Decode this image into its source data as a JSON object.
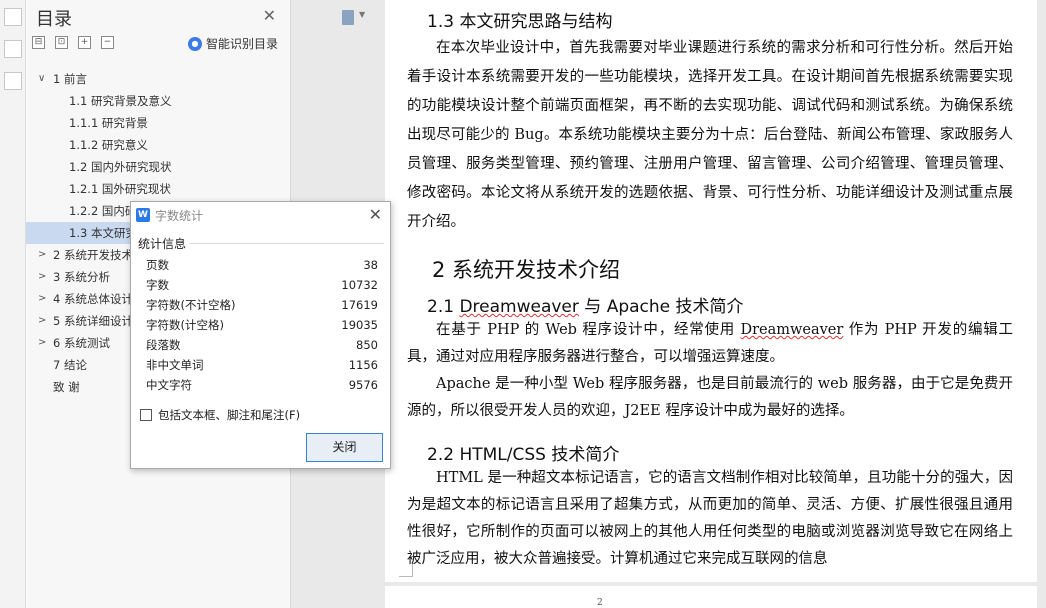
{
  "outline": {
    "title": "目录",
    "smart_label": "智能识别目录",
    "tools": [
      "⊟",
      "⊡",
      "+",
      "−"
    ],
    "items": [
      {
        "label": "1  前言",
        "level": 1,
        "expandable": true,
        "expanded": true
      },
      {
        "label": "1.1 研究背景及意义",
        "level": 2
      },
      {
        "label": "1.1.1  研究背景",
        "level": 2
      },
      {
        "label": "1.1.2  研究意义",
        "level": 2
      },
      {
        "label": "1.2 国内外研究现状",
        "level": 2
      },
      {
        "label": "1.2.1 国外研究现状",
        "level": 2
      },
      {
        "label": "1.2.2 国内研究现状",
        "level": 2
      },
      {
        "label": "1.3 本文研究思路与结构",
        "level": 2,
        "selected": true
      },
      {
        "label": "2 系统开发技术介绍",
        "level": 1,
        "expandable": true
      },
      {
        "label": "3  系统分析",
        "level": 1,
        "expandable": true
      },
      {
        "label": "4  系统总体设计",
        "level": 1,
        "expandable": true
      },
      {
        "label": "5  系统详细设计",
        "level": 1,
        "expandable": true
      },
      {
        "label": "6  系统测试",
        "level": 1,
        "expandable": true
      },
      {
        "label": "7 结论",
        "level": 1
      },
      {
        "label": "致  谢",
        "level": 1
      }
    ]
  },
  "document": {
    "heading_1_3": "1.3 本文研究思路与结构",
    "para_1_3": "在本次毕业设计中，首先我需要对毕业课题进行系统的需求分析和可行性分析。然后开始着手设计本系统需要开发的一些功能模块，选择开发工具。在设计期间首先根据系统需要实现的功能模块设计整个前端页面框架，再不断的去实现功能、调试代码和测试系统。为确保系统出现尽可能少的 Bug。本系统功能模块主要分为十点：后台登陆、新闻公布管理、家政服务人员管理、服务类型管理、预约管理、注册用户管理、留言管理、公司介绍管理、管理员管理、修改密码。本论文将从系统开发的选题依据、背景、可行性分析、功能详细设计及测试重点展开介绍。",
    "heading_2": "2 系统开发技术介绍",
    "heading_2_1_prefix": "2.1 ",
    "heading_2_1_word": "Dreamweaver",
    "heading_2_1_suffix": " 与 Apache 技术简介",
    "para_2_1a_prefix": "在基于 PHP 的 Web 程序设计中，经常使用 ",
    "para_2_1a_word": "Dreamweaver",
    "para_2_1a_suffix": " 作为 PHP 开发的编辑工具，通过对应用程序服务器进行整合，可以增强运算速度。",
    "para_2_1b": "Apache 是一种小型 Web 程序服务器，也是目前最流行的 web 服务器，由于它是免费开源的，所以很受开发人员的欢迎，J2EE 程序设计中成为最好的选择。",
    "heading_2_2": "2.2 HTML/CSS 技术简介",
    "para_2_2": "HTML 是一种超文本标记语言，它的语言文档制作相对比较简单，且功能十分的强大，因为是超文本的标记语言且采用了超集方式，从而更加的简单、灵活、方便、扩展性很强且通用性很好，它所制作的页面可以被网上的其他人用任何类型的电脑或浏览器浏览导致它在网络上被广泛应用，被大众普遍接受。计算机通过它来完成互联网的信息",
    "page_number": "2"
  },
  "dialog": {
    "title": "字数统计",
    "group_label": "统计信息",
    "stats": [
      {
        "label": "页数",
        "value": "38"
      },
      {
        "label": "字数",
        "value": "10732"
      },
      {
        "label": "字符数(不计空格)",
        "value": "17619"
      },
      {
        "label": "字符数(计空格)",
        "value": "19035"
      },
      {
        "label": "段落数",
        "value": "850"
      },
      {
        "label": "非中文单词",
        "value": "1156"
      },
      {
        "label": "中文字符",
        "value": "9576"
      }
    ],
    "checkbox_label": "包括文本框、脚注和尾注(F)",
    "checkbox_checked": false,
    "close_button": "关闭",
    "icon_letter": "W"
  }
}
